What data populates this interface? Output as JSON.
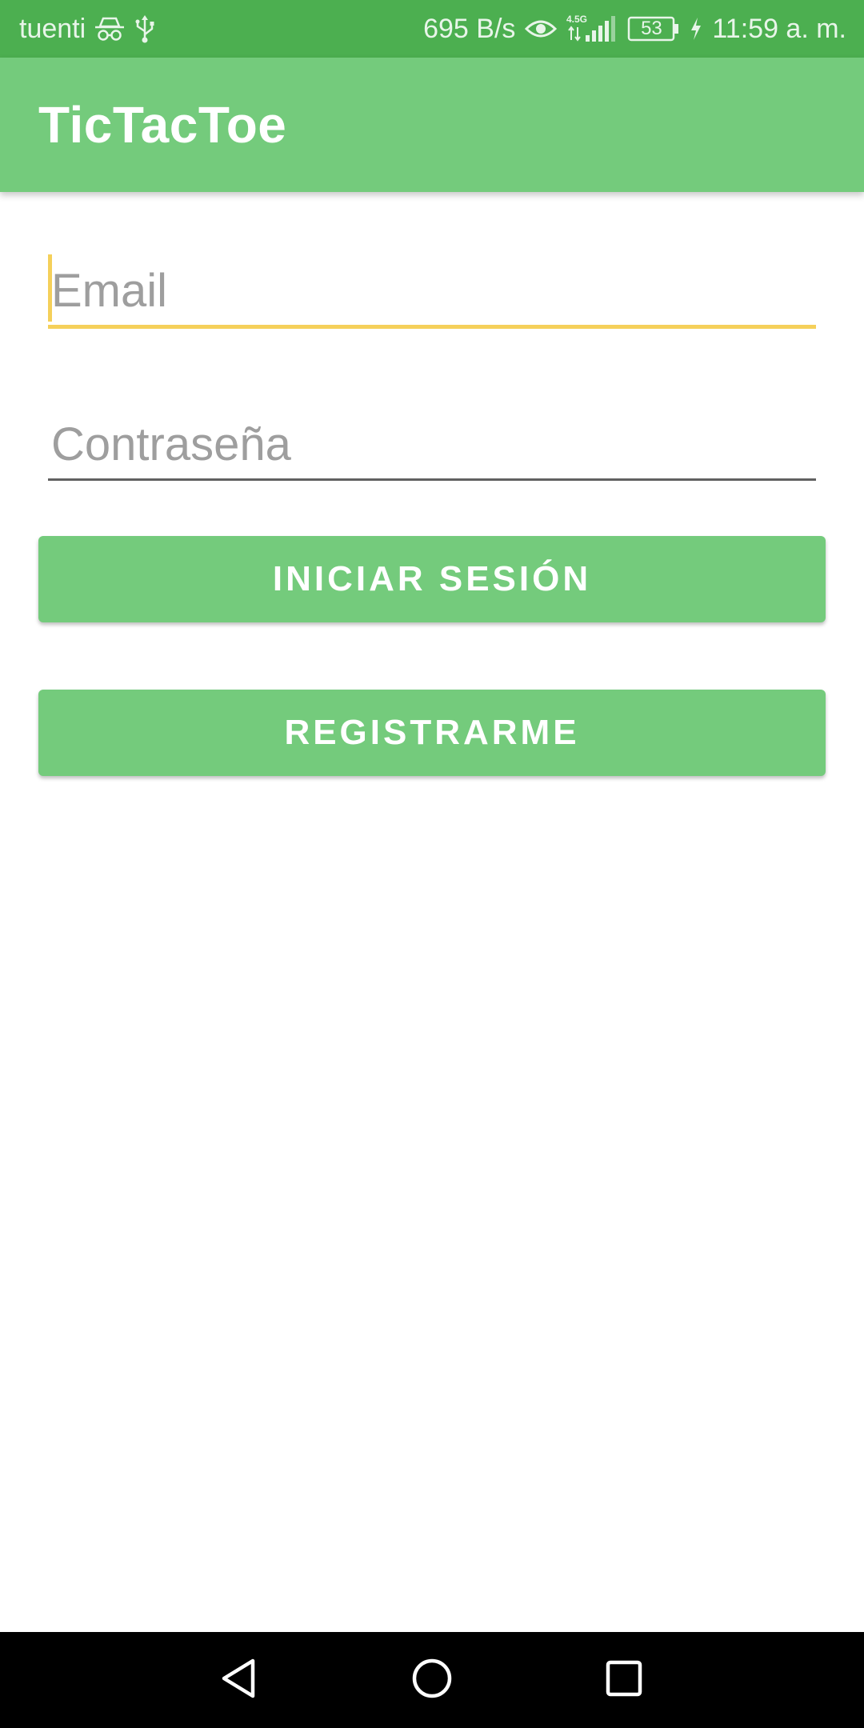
{
  "status_bar": {
    "carrier": "tuenti",
    "net_speed": "695 B/s",
    "network_type": "4.5G",
    "battery": "53",
    "time": "11:59 a. m.",
    "icons": [
      "incognito-icon",
      "usb-icon",
      "eye-icon",
      "signal-icon",
      "battery-icon",
      "charging-icon"
    ]
  },
  "app_bar": {
    "title": "TicTacToe"
  },
  "form": {
    "email_placeholder": "Email",
    "email_value": "",
    "password_placeholder": "Contraseña",
    "password_value": ""
  },
  "buttons": {
    "login_label": "INICIAR SESIÓN",
    "register_label": "REGISTRARME"
  },
  "nav_bar": {
    "icons": [
      "back-icon",
      "home-icon",
      "recents-icon"
    ]
  },
  "colors": {
    "status_bar": "#4CAF50",
    "primary": "#74CB7C",
    "accent": "#F5D05A",
    "nav_bar": "#000000"
  }
}
